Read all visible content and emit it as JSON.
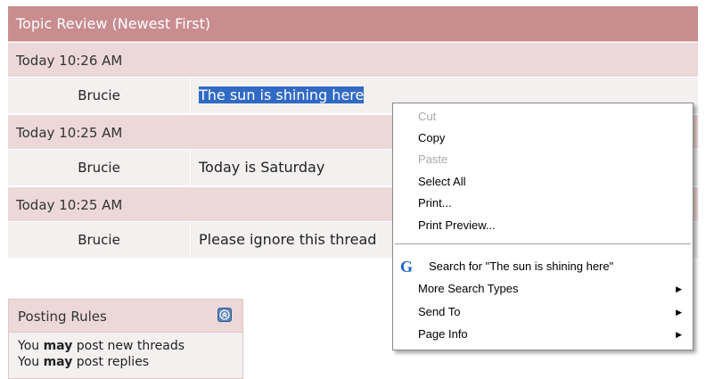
{
  "review": {
    "header": "Topic Review (Newest First)",
    "posts": [
      {
        "date": "Today 10:26 AM",
        "author": "Brucie",
        "message": "The sun is shining here"
      },
      {
        "date": "Today 10:25 AM",
        "author": "Brucie",
        "message": "Today is Saturday"
      },
      {
        "date": "Today 10:25 AM",
        "author": "Brucie",
        "message": "Please ignore this thread"
      }
    ]
  },
  "rules": {
    "title": "Posting Rules",
    "line1_prefix": "You ",
    "line1_bold": "may",
    "line1_suffix": " post new threads",
    "line2_prefix": "You ",
    "line2_bold": "may",
    "line2_suffix": " post replies"
  },
  "context_menu": {
    "cut": "Cut",
    "copy": "Copy",
    "paste": "Paste",
    "select_all": "Select All",
    "print": "Print...",
    "print_preview": "Print Preview...",
    "search": "Search for \"The sun is shining here\"",
    "more_search": "More Search Types",
    "send_to": "Send To",
    "page_info": "Page Info",
    "arrow": "▶"
  },
  "colors": {
    "header_bg": "#c98d8f",
    "row_bg": "#ecd8d8",
    "selection": "#316ac5"
  }
}
